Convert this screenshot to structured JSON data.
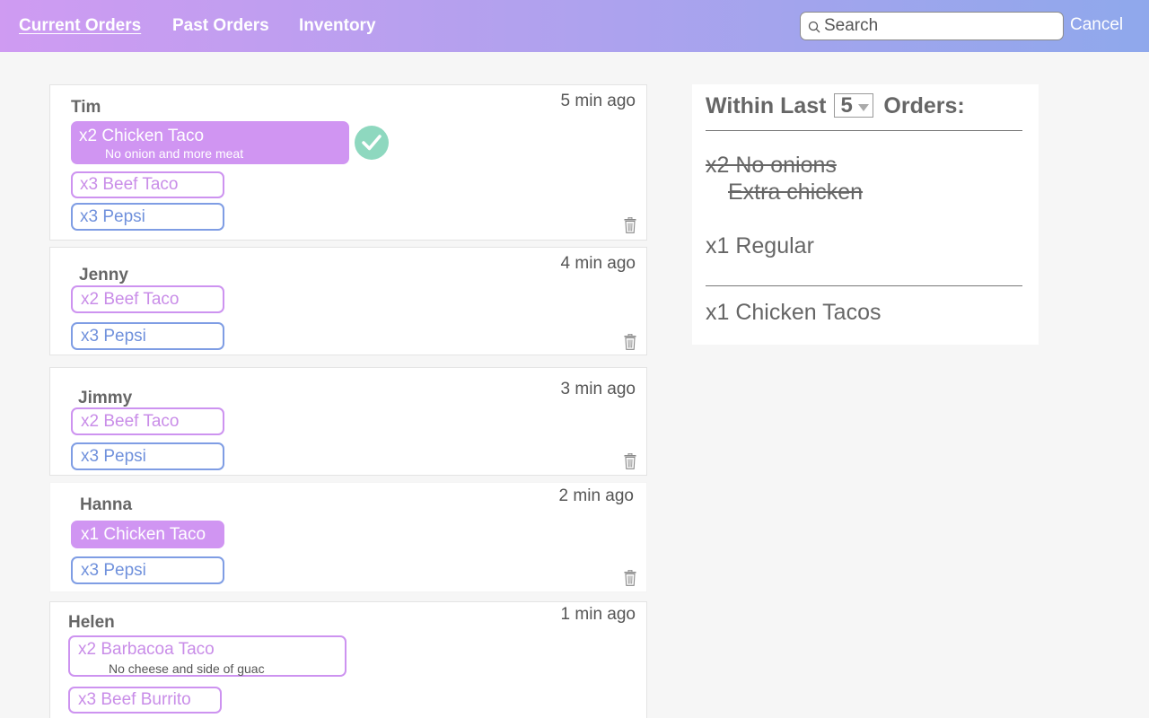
{
  "nav": {
    "tabs": [
      {
        "label": "Current Orders",
        "active": true
      },
      {
        "label": "Past Orders",
        "active": false
      },
      {
        "label": "Inventory",
        "active": false
      }
    ],
    "search_placeholder": "Search",
    "cancel_label": "Cancel"
  },
  "colors": {
    "header_gradient": [
      "#cf9bf2",
      "#8fa8ec"
    ],
    "food_accent": "#cd93f0",
    "drink_accent": "#7f9de4",
    "done_check": "#8ed8bf"
  },
  "orders": [
    {
      "customer": "Tim",
      "time": "5 min ago",
      "items": [
        {
          "label": "x2 Chicken Taco",
          "note": "No onion and more meat",
          "status": "selected",
          "kind": "food"
        },
        {
          "label": "x3 Beef Taco",
          "kind": "food"
        },
        {
          "label": "x3 Pepsi",
          "kind": "drink"
        }
      ]
    },
    {
      "customer": "Jenny",
      "time": "4 min ago",
      "items": [
        {
          "label": "x2 Beef Taco",
          "kind": "food"
        },
        {
          "label": "x3 Pepsi",
          "kind": "drink"
        }
      ]
    },
    {
      "customer": "Jimmy",
      "time": "3 min ago",
      "items": [
        {
          "label": "x2 Beef Taco",
          "kind": "food"
        },
        {
          "label": "x3 Pepsi",
          "kind": "drink"
        }
      ]
    },
    {
      "customer": "Hanna",
      "time": "2 min ago",
      "items": [
        {
          "label": "x1 Chicken Taco",
          "status": "selected",
          "kind": "food"
        },
        {
          "label": "x3 Pepsi",
          "kind": "drink"
        }
      ]
    },
    {
      "customer": "Helen",
      "time": "1 min ago",
      "items": [
        {
          "label": "x2 Barbacoa Taco",
          "note": "No cheese and side of guac",
          "kind": "food"
        },
        {
          "label": "x3 Beef Burrito",
          "kind": "food"
        }
      ]
    }
  ],
  "summary": {
    "heading_prefix": "Within Last",
    "selected_count": "5",
    "heading_suffix": "Orders:",
    "groups": [
      {
        "lines": [
          "x2 No onions",
          "Extra chicken"
        ],
        "completed": true
      },
      {
        "lines": [
          "x1 Regular"
        ],
        "completed": false
      },
      {
        "lines": [
          "x1 Chicken Tacos"
        ],
        "completed": false
      }
    ]
  }
}
